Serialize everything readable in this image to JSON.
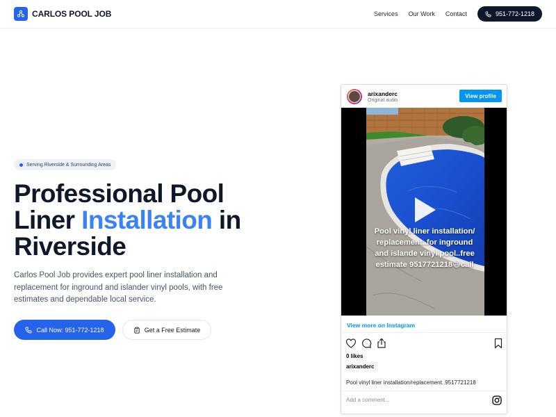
{
  "header": {
    "brand": "CARLOS POOL JOB",
    "nav": [
      "Services",
      "Our Work",
      "Contact"
    ],
    "phone": "951-772-1218"
  },
  "hero": {
    "badge": "Serving Riverside & Surrounding Areas",
    "title_line1": "Professional Pool",
    "title_line2_start": "Liner ",
    "title_line2_accent": "Installation",
    "title_line2_end": " in",
    "title_line3": "Riverside",
    "description": "Carlos Pool Job provides expert pool liner installation and replacement for inground and islander vinyl pools, with free estimates and dependable local service.",
    "call_button": "Call Now: 951-772-1218",
    "estimate_button": "Get a Free Estimate"
  },
  "instagram": {
    "username": "arixanderc",
    "audio": "Original audio",
    "view_profile": "View profile",
    "overlay_text": "Pool vinyl liner installation/ replacement..for inground and islande vinyl pool..free estimate 9517721218😃call",
    "view_more": "View more on Instagram",
    "likes": "0 likes",
    "author": "arixanderc",
    "caption": "Pool vinyl liner installation/replacement..9517721218",
    "comment_placeholder": "Add a comment..."
  },
  "colors": {
    "brand_blue": "#2563eb",
    "accent_blue": "#3b82f6",
    "dark": "#0f172a",
    "instagram_blue": "#0095f6"
  }
}
